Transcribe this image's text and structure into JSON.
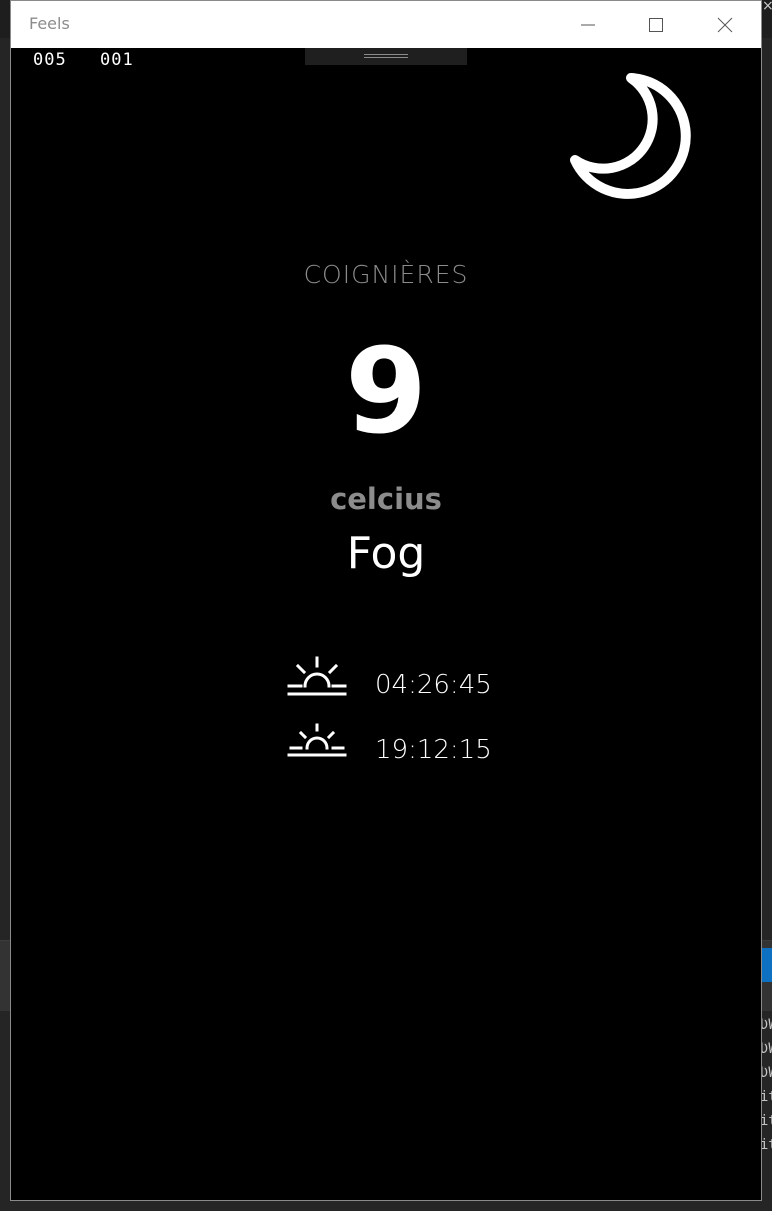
{
  "window": {
    "title": "Feels"
  },
  "counters": {
    "first": "005",
    "second": "001"
  },
  "weather": {
    "city": "COIGNIÈRES",
    "temperature": "9",
    "unit": "celcius",
    "condition": "Fog",
    "night_icon": "moon-icon"
  },
  "sun": {
    "sunrise_icon": "sunrise-icon",
    "sunrise_time": "04:26:45",
    "sunset_icon": "sunset-icon",
    "sunset_time": "19:12:15"
  },
  "background_editor": {
    "lines": [
      "ƲW",
      "ƲW",
      "ƲW",
      "it",
      "it",
      "it"
    ]
  },
  "colors": {
    "background": "#000000",
    "titlebar": "#ffffff",
    "muted_text": "#8c8c8c",
    "primary_text": "#ffffff"
  }
}
